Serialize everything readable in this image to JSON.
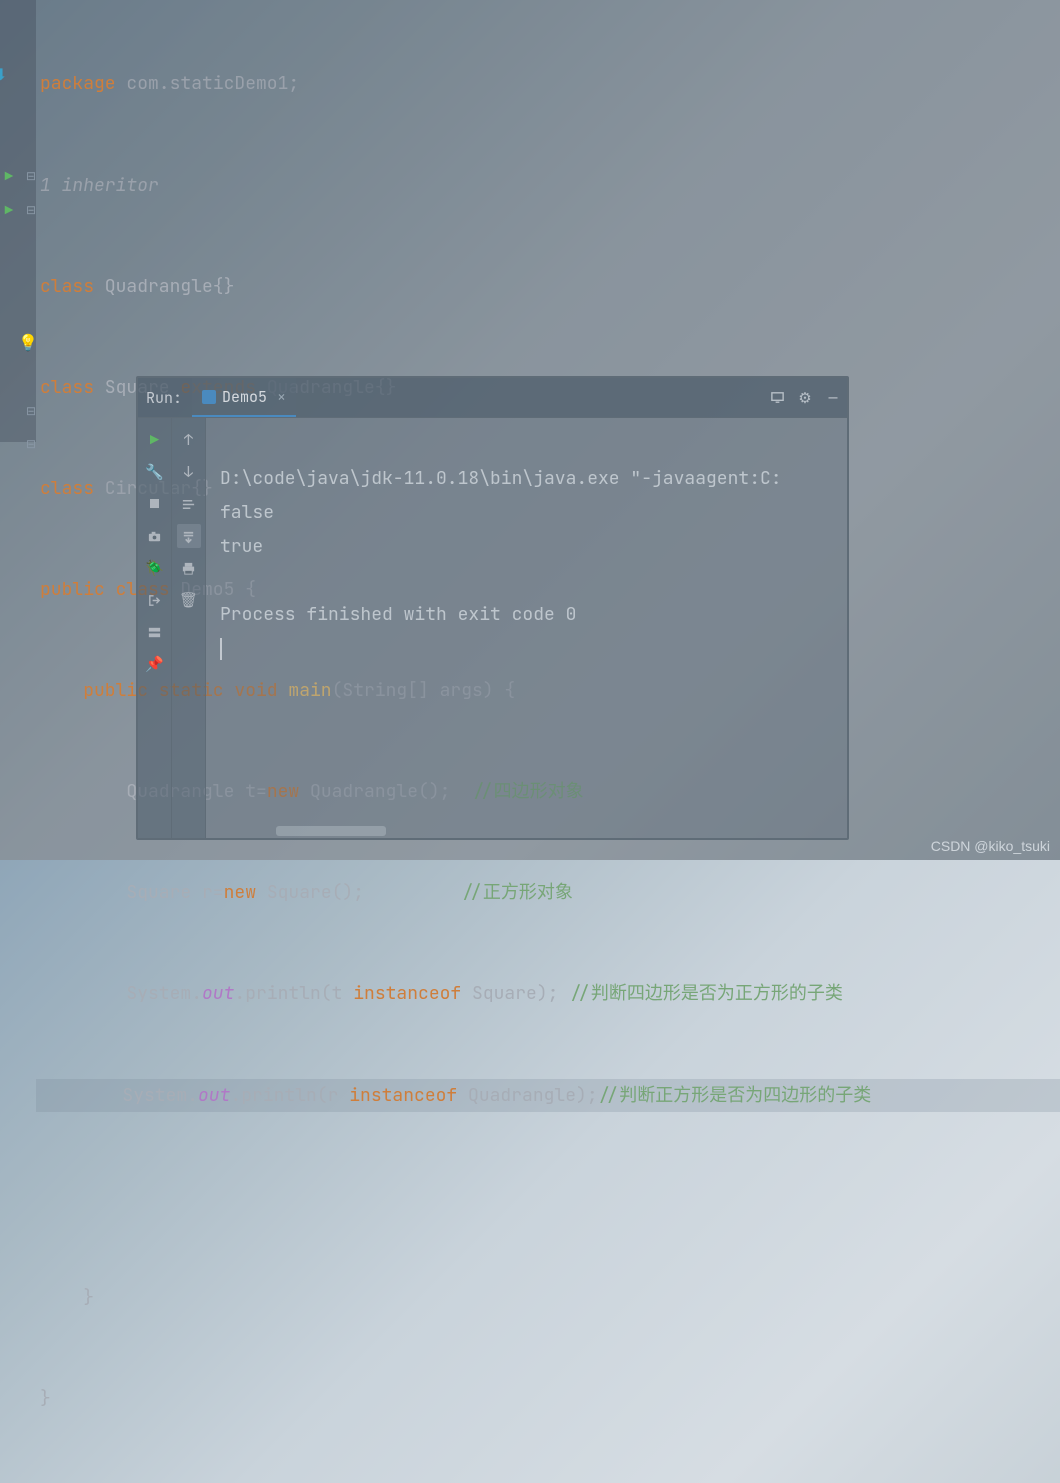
{
  "editor": {
    "lines": {
      "l0_a": "package",
      "l0_b": " com.staticDemo1;",
      "l1": "1 inheritor",
      "l2_a": "class",
      "l2_b": " Quadrangle{}",
      "l3_a": "class",
      "l3_b": " Square ",
      "l3_c": "extends",
      "l3_d": " Quadrangle{}",
      "l4_a": "class",
      "l4_b": " Circular",
      "l4_c": "{}",
      "l5_a": "public class",
      "l5_b": " Demo5 {",
      "l6_a": "    public static void",
      "l6_b": " main",
      "l6_c": "(String[] args) {",
      "l7_a": "        Quadrangle t=",
      "l7_b": "new",
      "l7_c": " Quadrangle();  ",
      "l7_d": "//四边形对象",
      "l8_a": "        Square r=",
      "l8_b": "new",
      "l8_c": " Square();         ",
      "l8_d": "//正方形对象",
      "l9_a": "        System.",
      "l9_b": "out",
      "l9_c": ".println(t ",
      "l9_d": "instanceof",
      "l9_e": " Square); ",
      "l9_f": "//判断四边形是否为正方形的子类",
      "l10_a": "        System.",
      "l10_b": "out",
      "l10_c": ".println(r ",
      "l10_d": "instanceof",
      "l10_e": " Quadrangle);",
      "l10_f": "//判断正方形是否为四边形的子类",
      "l11": "    }",
      "l12": "}"
    }
  },
  "run": {
    "title": "Run:",
    "tab_label": "Demo5",
    "console": {
      "l0": "D:\\code\\java\\jdk-11.0.18\\bin\\java.exe \"-javaagent:C:",
      "l1": "false",
      "l2": "true",
      "l3": "",
      "l4": "Process finished with exit code 0"
    },
    "tools": {
      "play": "play-icon",
      "stop": "stop-icon",
      "wrench": "wrench-icon",
      "up": "arrow-up-icon",
      "down": "arrow-down-icon",
      "wrap": "wrap-icon",
      "scroll": "scroll-icon",
      "camera": "camera-icon",
      "print": "print-icon",
      "bug": "bug-icon",
      "trash": "trash-icon",
      "exit": "exit-icon",
      "layout": "layout-icon",
      "pin": "pin-icon"
    },
    "header_icons": {
      "monitor": "monitor-icon",
      "gear": "gear-icon",
      "minimize": "minimize-icon"
    }
  },
  "watermark": "CSDN @kiko_tsuki"
}
